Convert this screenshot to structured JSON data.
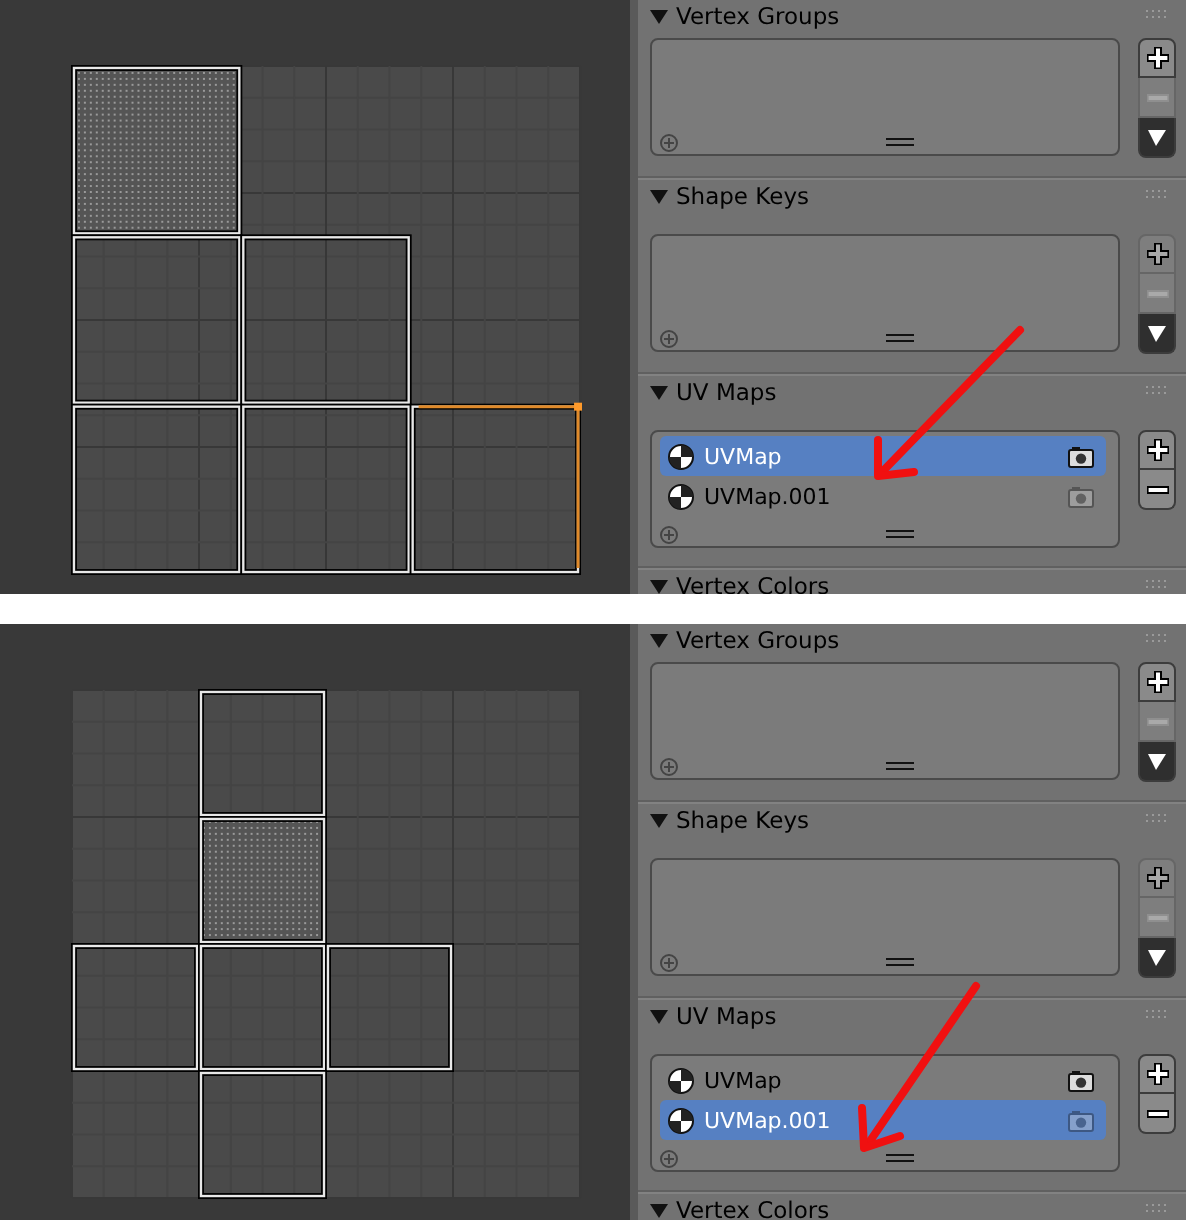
{
  "screens": [
    {
      "uv_editor": {
        "kind": "l-shape",
        "faces": [
          {
            "selected": true
          },
          {
            "selected": false
          },
          {
            "selected": false
          },
          {
            "selected": false
          },
          {
            "selected": false
          },
          {
            "selected": false
          }
        ]
      },
      "sections": [
        {
          "title": "Vertex Groups",
          "kind": "list",
          "buttons": [
            {
              "kind": "add",
              "disabled": false
            },
            {
              "kind": "remove",
              "disabled": true
            },
            {
              "kind": "menu",
              "disabled": false
            }
          ]
        },
        {
          "title": "Shape Keys",
          "kind": "list",
          "buttons": [
            {
              "kind": "add",
              "disabled": true
            },
            {
              "kind": "remove",
              "disabled": true
            },
            {
              "kind": "menu",
              "disabled": false
            }
          ]
        },
        {
          "title": "UV Maps",
          "kind": "list",
          "items": [
            {
              "name": "UVMap",
              "selected": true,
              "render_active": true
            },
            {
              "name": "UVMap.001",
              "selected": false,
              "render_active": false
            }
          ],
          "buttons": [
            {
              "kind": "add",
              "disabled": false
            },
            {
              "kind": "remove",
              "disabled": false
            }
          ]
        },
        {
          "title": "Vertex Colors",
          "kind": "header"
        }
      ]
    },
    {
      "uv_editor": {
        "kind": "cross",
        "faces": [
          {
            "selected": false
          },
          {
            "selected": true
          },
          {
            "selected": false
          },
          {
            "selected": false
          },
          {
            "selected": false
          },
          {
            "selected": false
          }
        ]
      },
      "sections": [
        {
          "title": "Vertex Groups",
          "kind": "list",
          "buttons": [
            {
              "kind": "add",
              "disabled": false
            },
            {
              "kind": "remove",
              "disabled": true
            },
            {
              "kind": "menu",
              "disabled": false
            }
          ]
        },
        {
          "title": "Shape Keys",
          "kind": "list",
          "buttons": [
            {
              "kind": "add",
              "disabled": true
            },
            {
              "kind": "remove",
              "disabled": true
            },
            {
              "kind": "menu",
              "disabled": false
            }
          ]
        },
        {
          "title": "UV Maps",
          "kind": "list",
          "items": [
            {
              "name": "UVMap",
              "selected": false,
              "render_active": true
            },
            {
              "name": "UVMap.001",
              "selected": true,
              "render_active": false
            }
          ],
          "buttons": [
            {
              "kind": "add",
              "disabled": false
            },
            {
              "kind": "remove",
              "disabled": false
            }
          ]
        },
        {
          "title": "Vertex Colors",
          "kind": "header"
        }
      ]
    }
  ]
}
